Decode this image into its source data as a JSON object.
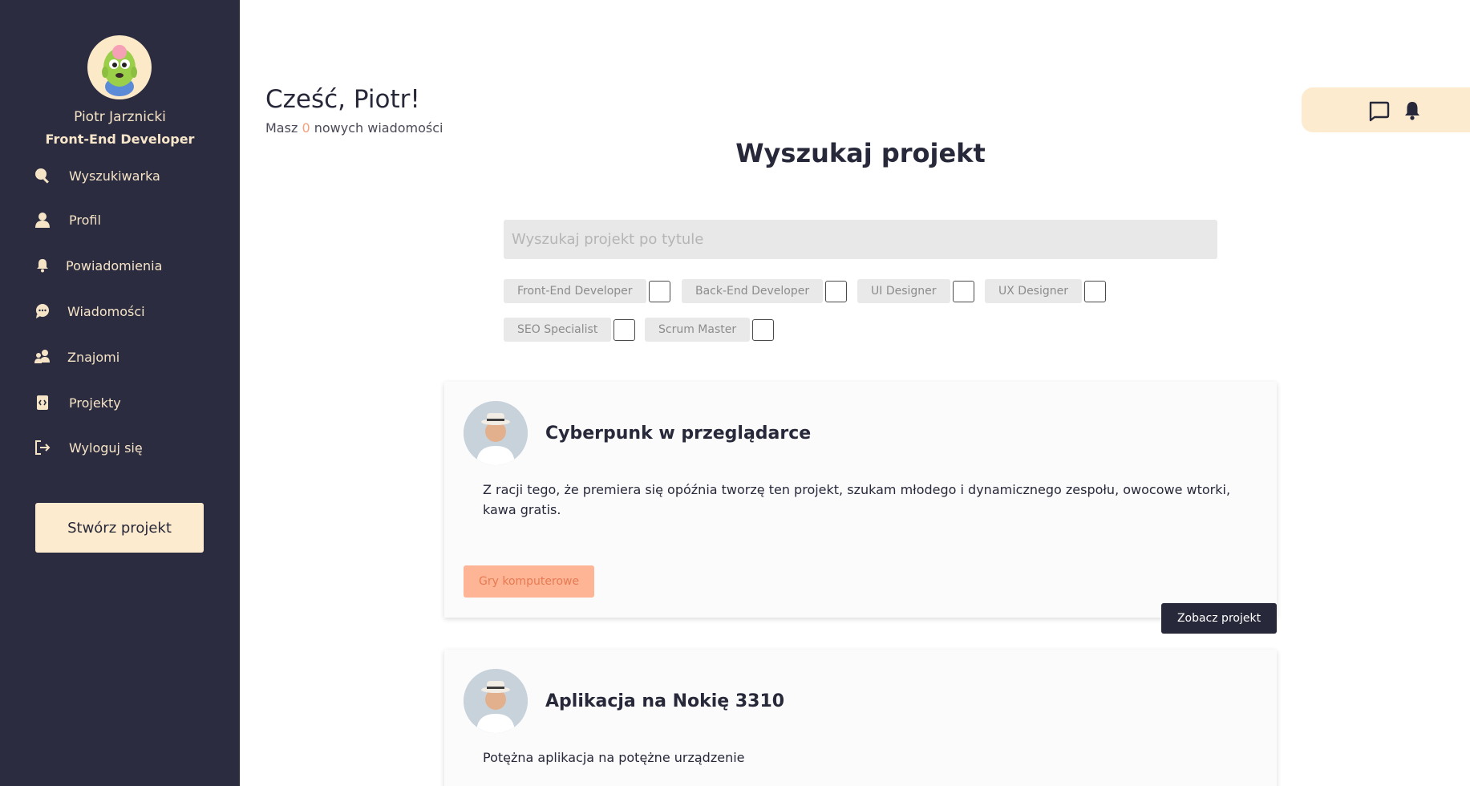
{
  "user": {
    "name": "Piotr Jarznicki",
    "role": "Front-End Developer"
  },
  "nav": {
    "items": [
      {
        "label": "Wyszukiwarka",
        "icon": "search-icon"
      },
      {
        "label": "Profil",
        "icon": "user-icon"
      },
      {
        "label": "Powiadomienia",
        "icon": "bell-icon"
      },
      {
        "label": "Wiadomości",
        "icon": "chat-icon"
      },
      {
        "label": "Znajomi",
        "icon": "friends-icon"
      },
      {
        "label": "Projekty",
        "icon": "code-file-icon"
      },
      {
        "label": "Wyloguj się",
        "icon": "logout-icon"
      }
    ],
    "create_label": "Stwórz projekt"
  },
  "header": {
    "greeting": "Cześć, Piotr!",
    "messages_prefix": "Masz",
    "messages_count": "0",
    "messages_suffix": "nowych wiadomości"
  },
  "search": {
    "title": "Wyszukaj projekt",
    "placeholder": "Wyszukaj projekt po tytule",
    "filters": [
      "Front-End Developer",
      "Back-End Developer",
      "UI Designer",
      "UX Designer",
      "SEO Specialist",
      "Scrum Master"
    ]
  },
  "projects": [
    {
      "title": "Cyberpunk w przeglądarce",
      "description": "Z racji tego, że premiera się opóźnia tworzę ten projekt, szukam młodego i dynamicznego zespołu, owocowe wtorki, kawa gratis.",
      "tag": "Gry komputerowe",
      "action": "Zobacz projekt"
    },
    {
      "title": "Aplikacja na Nokię 3310",
      "description": "Potężna aplikacja na potężne urządzenie"
    }
  ],
  "colors": {
    "sidebar": "#2b2c40",
    "accent_cream": "#fdebcf",
    "accent_salmon": "#fdb595",
    "dark": "#272839"
  }
}
